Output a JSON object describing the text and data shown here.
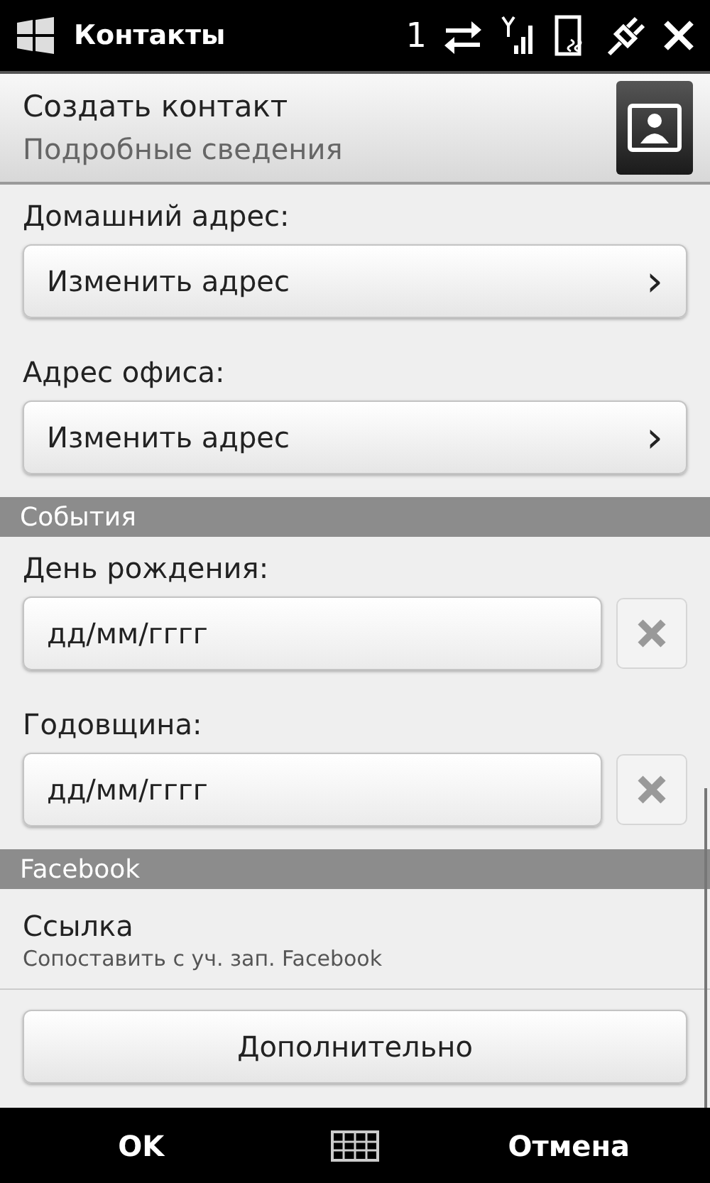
{
  "status_bar": {
    "title": "Контакты",
    "notification_count": "1"
  },
  "header": {
    "title": "Создать контакт",
    "subtitle": "Подробные сведения"
  },
  "address_fields": [
    {
      "label": "Домашний адрес:",
      "value": "Изменить адрес",
      "arrow": "›"
    },
    {
      "label": "Адрес офиса:",
      "value": "Изменить адрес",
      "arrow": "›"
    }
  ],
  "events": {
    "heading": "События",
    "fields": [
      {
        "label": "День рождения:",
        "placeholder": "дд/мм/гггг"
      },
      {
        "label": "Годовщина:",
        "placeholder": "дд/мм/гггг"
      }
    ]
  },
  "facebook": {
    "heading": "Facebook",
    "link_title": "Ссылка",
    "link_subtitle": "Сопоставить с уч. зап. Facebook"
  },
  "more_button": "Дополнительно",
  "softkeys": {
    "left": "OK",
    "right": "Отмена"
  }
}
